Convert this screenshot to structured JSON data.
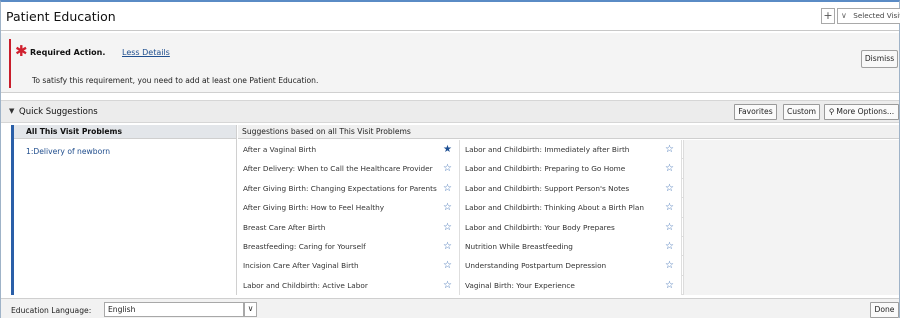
{
  "window": {
    "title": "Patient Education",
    "add_label": "+",
    "selected_visit_label": "Selected Visit"
  },
  "banner": {
    "required_label": "Required Action.",
    "less_details_label": "Less Details",
    "message": "To satisfy this requirement, you need to add at least one Patient Education.",
    "dismiss_label": "Dismiss",
    "accent_color": "#c81d2b"
  },
  "quick_suggestions": {
    "title": "Quick Suggestions",
    "favorites_label": "Favorites",
    "custom_label": "Custom",
    "more_options_label": "More Options..."
  },
  "problems": {
    "header": "All This Visit Problems",
    "items": [
      "1:Delivery of newborn"
    ]
  },
  "suggestions": {
    "header": "Suggestions based on all This Visit Problems",
    "rows": [
      [
        {
          "text": "After a Vaginal Birth",
          "favorite": true
        },
        {
          "text": "Labor and Childbirth: Immediately after Birth",
          "favorite": false
        }
      ],
      [
        {
          "text": "After Delivery: When to Call the Healthcare Provider",
          "favorite": false
        },
        {
          "text": "Labor and Childbirth: Preparing to Go Home",
          "favorite": false
        }
      ],
      [
        {
          "text": "After Giving Birth: Changing Expectations for Parents",
          "favorite": false
        },
        {
          "text": "Labor and Childbirth: Support Person's Notes",
          "favorite": false
        }
      ],
      [
        {
          "text": "After Giving Birth: How to Feel Healthy",
          "favorite": false
        },
        {
          "text": "Labor and Childbirth: Thinking About a Birth Plan",
          "favorite": false
        }
      ],
      [
        {
          "text": "Breast Care After Birth",
          "favorite": false
        },
        {
          "text": "Labor and Childbirth: Your Body Prepares",
          "favorite": false
        }
      ],
      [
        {
          "text": "Breastfeeding: Caring for Yourself",
          "favorite": false
        },
        {
          "text": "Nutrition While Breastfeeding",
          "favorite": false
        }
      ],
      [
        {
          "text": "Incision Care After Vaginal Birth",
          "favorite": false
        },
        {
          "text": "Understanding Postpartum Depression",
          "favorite": false
        }
      ],
      [
        {
          "text": "Labor and Childbirth: Active Labor",
          "favorite": false
        },
        {
          "text": "Vaginal Birth: Your Experience",
          "favorite": false
        }
      ]
    ]
  },
  "footer": {
    "language_label": "Education Language:",
    "language_value": "English",
    "done_label": "Done"
  }
}
